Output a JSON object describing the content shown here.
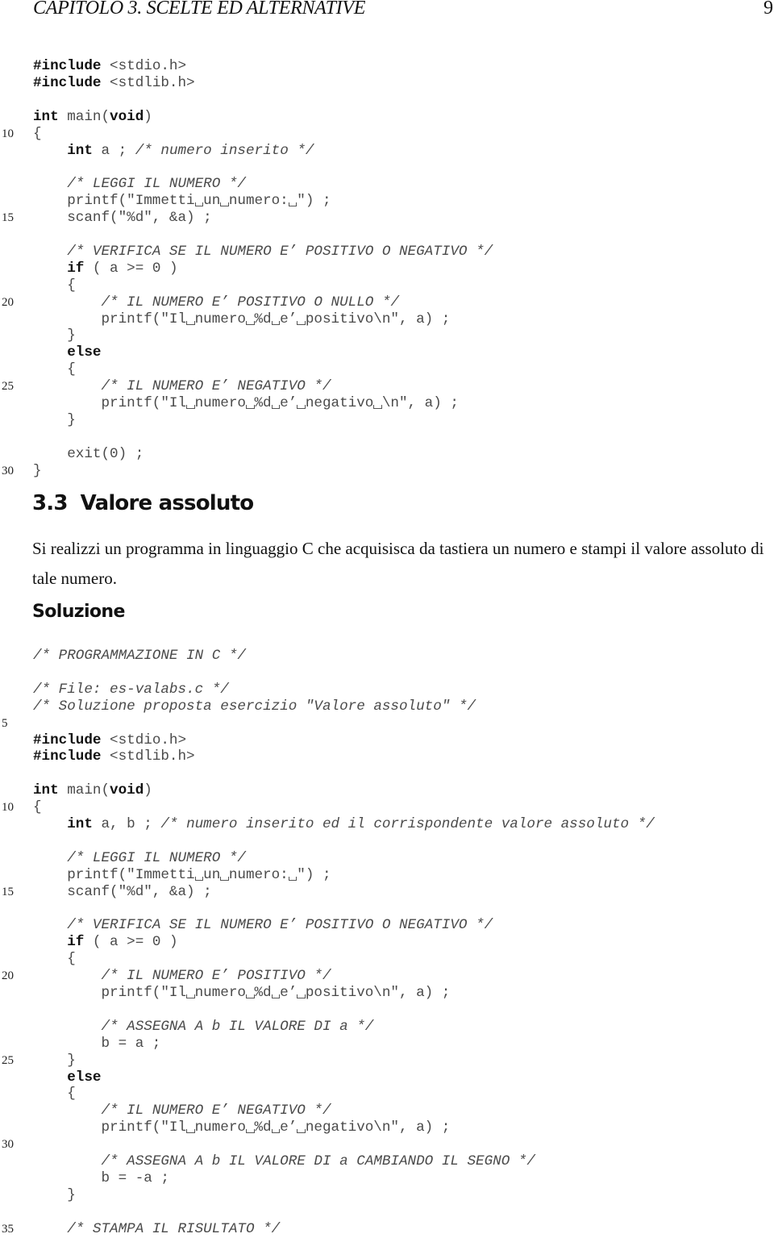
{
  "header": {
    "title": "CAPITOLO 3.  SCELTE ED ALTERNATIVE",
    "page_number": "9"
  },
  "listing1": {
    "first_line": 6,
    "lines": [
      [
        [
          "kw",
          "#include"
        ],
        [
          "n",
          " <stdio.h>"
        ]
      ],
      [
        [
          "kw",
          "#include"
        ],
        [
          "n",
          " <stdlib.h>"
        ]
      ],
      [],
      [
        [
          "kw",
          "int"
        ],
        [
          "n",
          " main("
        ],
        [
          "kw",
          "void"
        ],
        [
          "n",
          ")"
        ]
      ],
      [
        [
          "n",
          "{"
        ]
      ],
      [
        [
          "n",
          "    "
        ],
        [
          "kw",
          "int"
        ],
        [
          "n",
          " a ; "
        ],
        [
          "cm",
          "/* numero inserito */"
        ]
      ],
      [],
      [
        [
          "n",
          "    "
        ],
        [
          "cm",
          "/* LEGGI IL NUMERO */"
        ]
      ],
      [
        [
          "n",
          "    printf(\"Immetti␣un␣numero:␣\") ;"
        ]
      ],
      [
        [
          "n",
          "    scanf(\"%d\", &a) ;"
        ]
      ],
      [],
      [
        [
          "n",
          "    "
        ],
        [
          "cm",
          "/* VERIFICA SE IL NUMERO E’ POSITIVO O NEGATIVO */"
        ]
      ],
      [
        [
          "n",
          "    "
        ],
        [
          "kw",
          "if"
        ],
        [
          "n",
          " ( a >= 0 )"
        ]
      ],
      [
        [
          "n",
          "    {"
        ]
      ],
      [
        [
          "n",
          "        "
        ],
        [
          "cm",
          "/* IL NUMERO E’ POSITIVO O NULLO */"
        ]
      ],
      [
        [
          "n",
          "        printf(\"Il␣numero␣%d␣e’␣positivo\\n\", a) ;"
        ]
      ],
      [
        [
          "n",
          "    }"
        ]
      ],
      [
        [
          "n",
          "    "
        ],
        [
          "kw",
          "else"
        ]
      ],
      [
        [
          "n",
          "    {"
        ]
      ],
      [
        [
          "n",
          "        "
        ],
        [
          "cm",
          "/* IL NUMERO E’ NEGATIVO */"
        ]
      ],
      [
        [
          "n",
          "        printf(\"Il␣numero␣%d␣e’␣negativo␣\\n\", a) ;"
        ]
      ],
      [
        [
          "n",
          "    }"
        ]
      ],
      [],
      [
        [
          "n",
          "    exit(0) ;"
        ]
      ],
      [
        [
          "n",
          "}"
        ]
      ]
    ]
  },
  "section": {
    "number": "3.3",
    "title": "Valore assoluto",
    "text": "Si realizzi un programma in linguaggio C che acquisisca da tastiera un numero e stampi il valore assoluto di tale numero.",
    "solution_heading": "Soluzione"
  },
  "listing2": {
    "first_line": 1,
    "lines": [
      [
        [
          "cm",
          "/* PROGRAMMAZIONE IN C */"
        ]
      ],
      [],
      [
        [
          "cm",
          "/* File: es-valabs.c */"
        ]
      ],
      [
        [
          "cm",
          "/* Soluzione proposta esercizio \"Valore assoluto\" */"
        ]
      ],
      [],
      [
        [
          "kw",
          "#include"
        ],
        [
          "n",
          " <stdio.h>"
        ]
      ],
      [
        [
          "kw",
          "#include"
        ],
        [
          "n",
          " <stdlib.h>"
        ]
      ],
      [],
      [
        [
          "kw",
          "int"
        ],
        [
          "n",
          " main("
        ],
        [
          "kw",
          "void"
        ],
        [
          "n",
          ")"
        ]
      ],
      [
        [
          "n",
          "{"
        ]
      ],
      [
        [
          "n",
          "    "
        ],
        [
          "kw",
          "int"
        ],
        [
          "n",
          " a, b ; "
        ],
        [
          "cm",
          "/* numero inserito ed il corrispondente valore assoluto */"
        ]
      ],
      [],
      [
        [
          "n",
          "    "
        ],
        [
          "cm",
          "/* LEGGI IL NUMERO */"
        ]
      ],
      [
        [
          "n",
          "    printf(\"Immetti␣un␣numero:␣\") ;"
        ]
      ],
      [
        [
          "n",
          "    scanf(\"%d\", &a) ;"
        ]
      ],
      [],
      [
        [
          "n",
          "    "
        ],
        [
          "cm",
          "/* VERIFICA SE IL NUMERO E’ POSITIVO O NEGATIVO */"
        ]
      ],
      [
        [
          "n",
          "    "
        ],
        [
          "kw",
          "if"
        ],
        [
          "n",
          " ( a >= 0 )"
        ]
      ],
      [
        [
          "n",
          "    {"
        ]
      ],
      [
        [
          "n",
          "        "
        ],
        [
          "cm",
          "/* IL NUMERO E’ POSITIVO */"
        ]
      ],
      [
        [
          "n",
          "        printf(\"Il␣numero␣%d␣e’␣positivo\\n\", a) ;"
        ]
      ],
      [],
      [
        [
          "n",
          "        "
        ],
        [
          "cm",
          "/* ASSEGNA A b IL VALORE DI a */"
        ]
      ],
      [
        [
          "n",
          "        b = a ;"
        ]
      ],
      [
        [
          "n",
          "    }"
        ]
      ],
      [
        [
          "n",
          "    "
        ],
        [
          "kw",
          "else"
        ]
      ],
      [
        [
          "n",
          "    {"
        ]
      ],
      [
        [
          "n",
          "        "
        ],
        [
          "cm",
          "/* IL NUMERO E’ NEGATIVO */"
        ]
      ],
      [
        [
          "n",
          "        printf(\"Il␣numero␣%d␣e’␣negativo\\n\", a) ;"
        ]
      ],
      [],
      [
        [
          "n",
          "        "
        ],
        [
          "cm",
          "/* ASSEGNA A b IL VALORE DI a CAMBIANDO IL SEGNO */"
        ]
      ],
      [
        [
          "n",
          "        b = -a ;"
        ]
      ],
      [
        [
          "n",
          "    }"
        ]
      ],
      [],
      [
        [
          "n",
          "    "
        ],
        [
          "cm",
          "/* STAMPA IL RISULTATO */"
        ]
      ]
    ]
  }
}
